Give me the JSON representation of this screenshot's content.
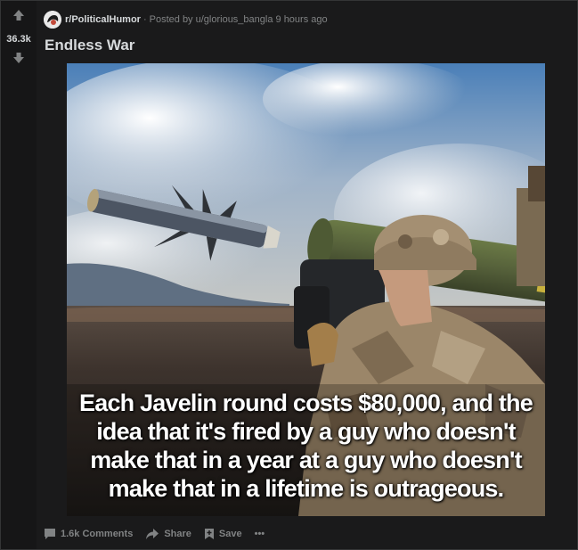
{
  "post": {
    "subreddit": "r/PoliticalHumor",
    "posted_by": "Posted by u/glorious_bangla 9 hours ago",
    "title": "Endless War",
    "score": "36.3k",
    "icons": {
      "upvote": "arrow-up-icon",
      "downvote": "arrow-down-icon",
      "subreddit": "subreddit-avatar-icon"
    }
  },
  "image": {
    "caption_lines": [
      "Each Javelin round costs $80,000, and the",
      "idea that it's fired by a guy who doesn't",
      "make that in a year at a guy who doesn't",
      "make that in a lifetime is outrageous."
    ]
  },
  "actions": {
    "comments": "1.6k Comments",
    "share": "Share",
    "save": "Save",
    "more": "•••"
  },
  "colors": {
    "background": "#1a1a1b",
    "text": "#d7dadc",
    "muted": "#818384"
  }
}
